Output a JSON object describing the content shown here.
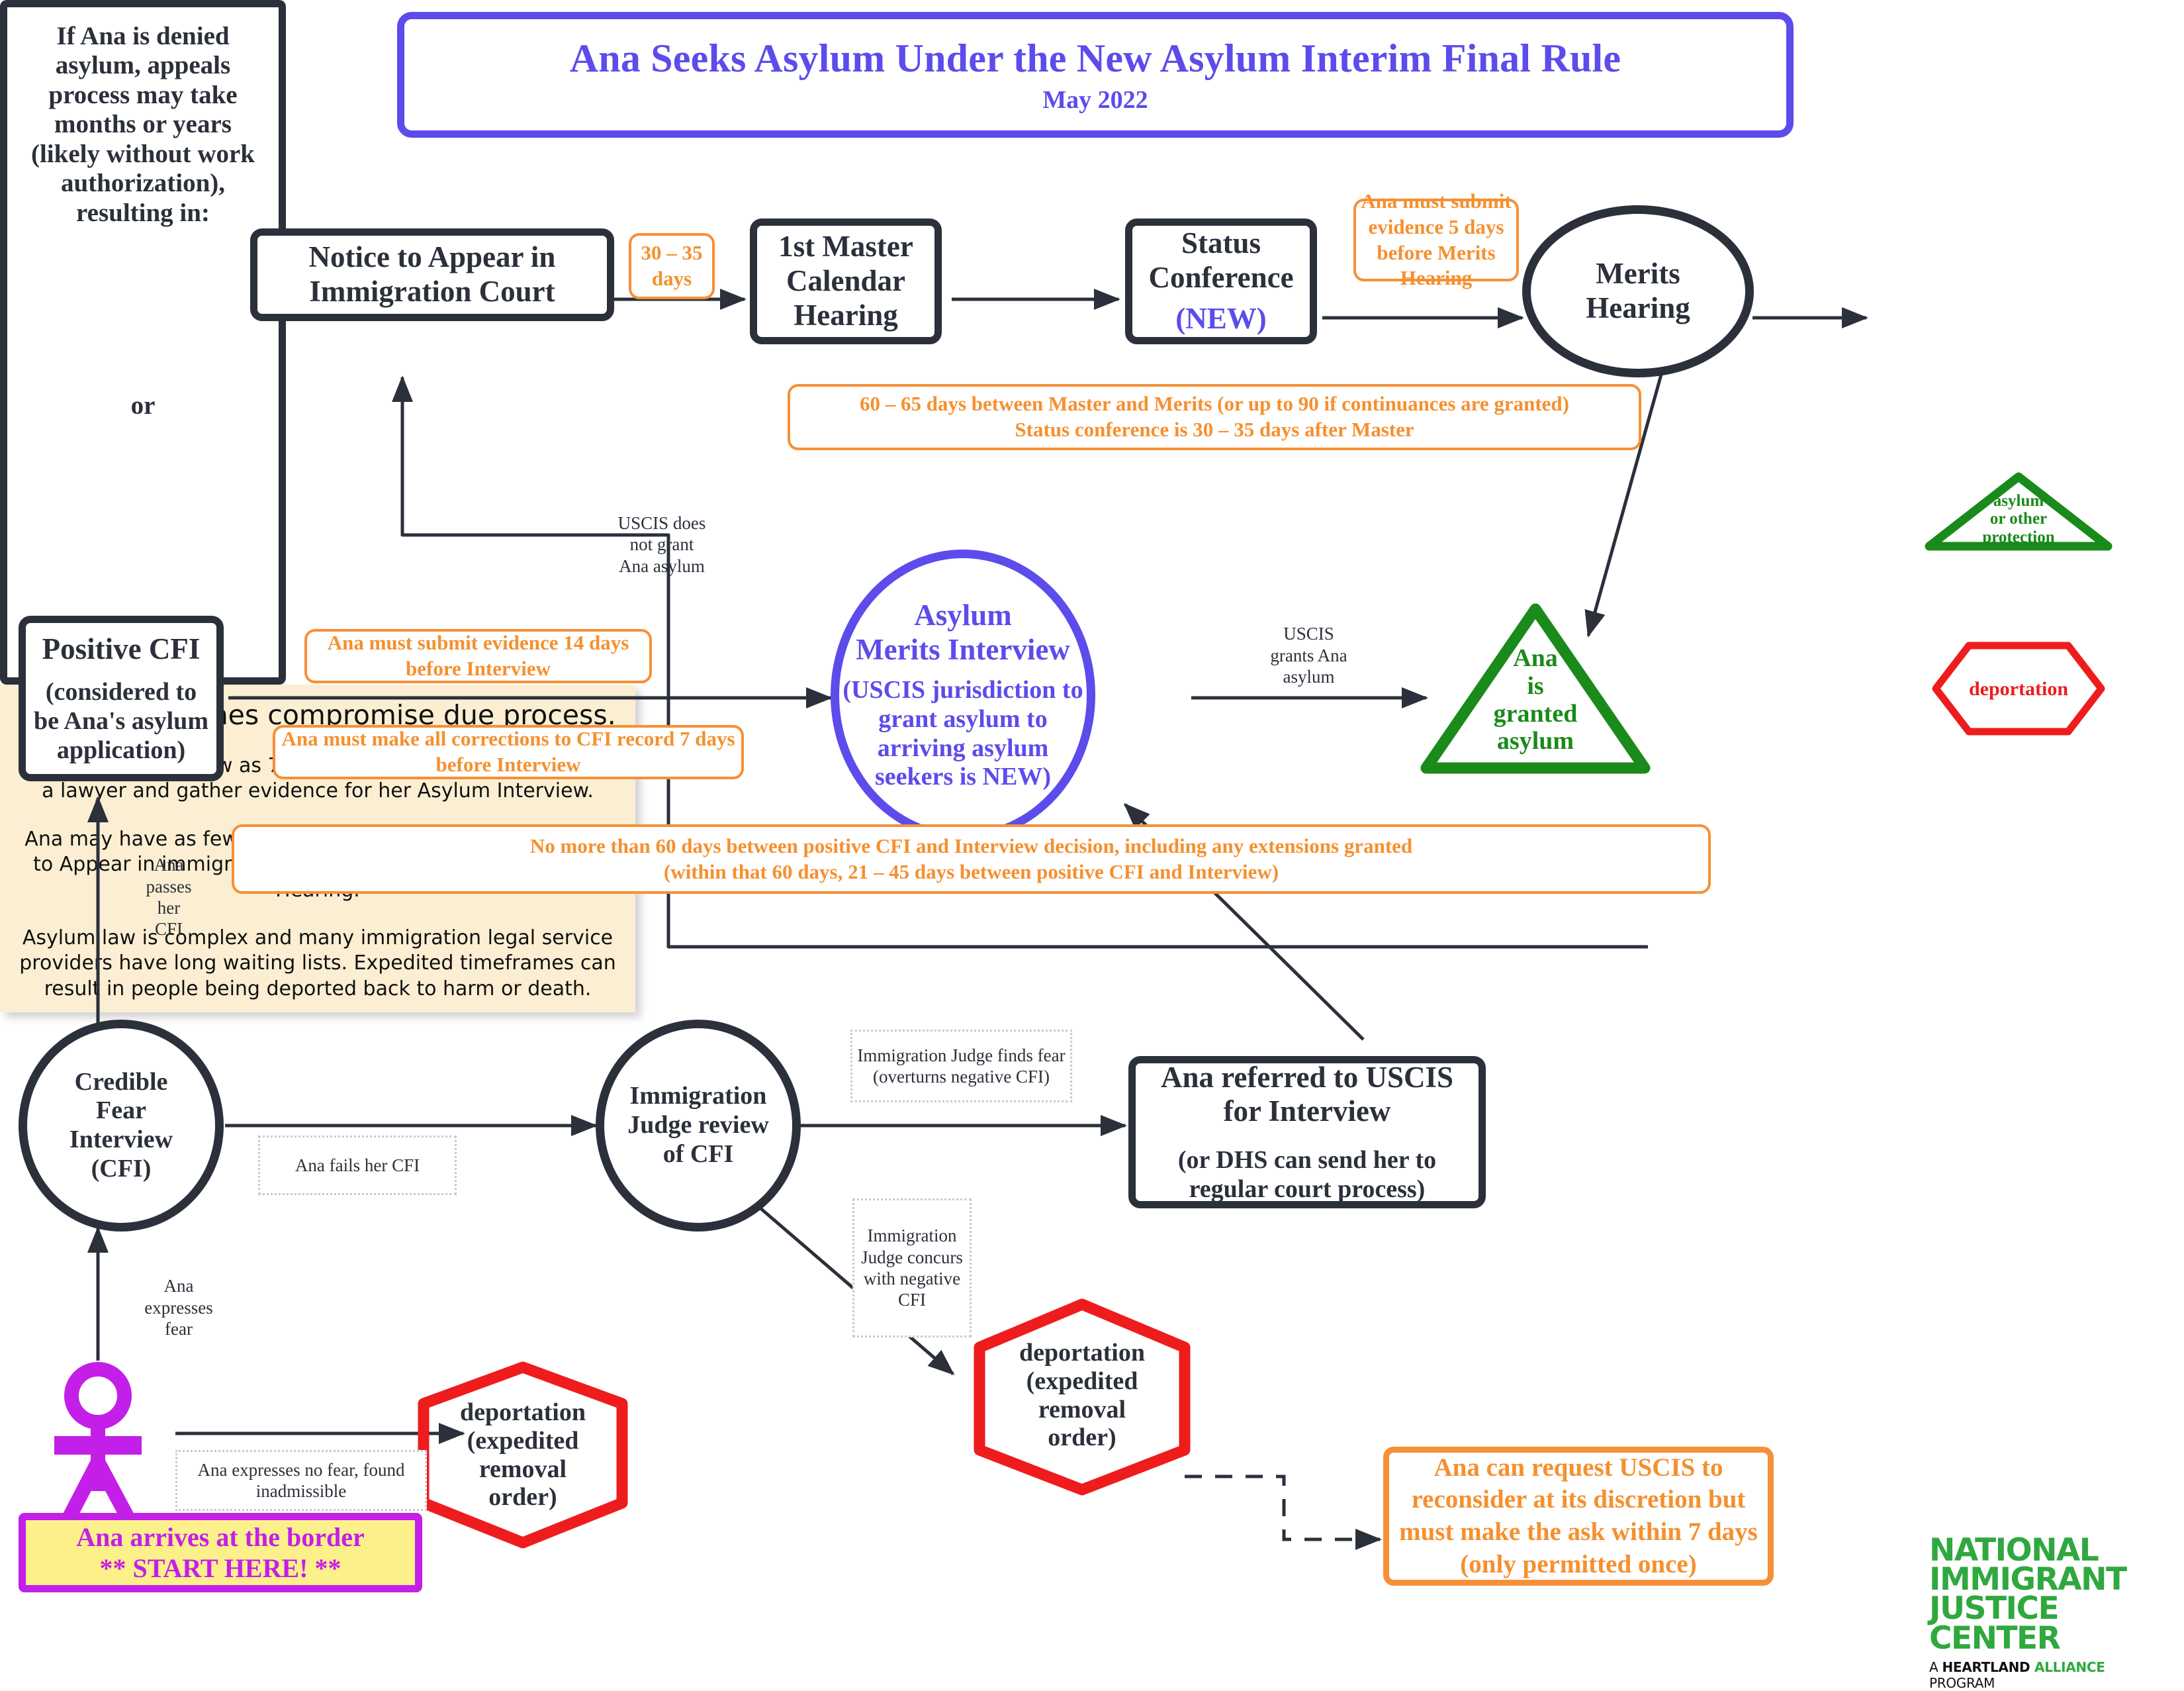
{
  "title": {
    "main": "Ana Seeks Asylum Under the New Asylum Interim Final Rule",
    "subtitle": "May 2022",
    "icon": "stick-figure-person-icon"
  },
  "colors": {
    "accent_purple": "#5c4ceb",
    "magenta": "#c31fe8",
    "orange": "#f5902f",
    "dark": "#2b303b",
    "green": "#1a8a1a",
    "red": "#ee1c1c",
    "cream": "#fbeed2",
    "yellow": "#fcf08a"
  },
  "nodes": {
    "notice_to_appear": "Notice to Appear in\nImmigration Court",
    "master_calendar": "1st Master\nCalendar\nHearing",
    "status_conference": "Status\nConference",
    "status_conference_new": "(NEW)",
    "merits_hearing": "Merits\nHearing",
    "positive_cfi_title": "Positive CFI",
    "positive_cfi_sub": "(considered to\nbe Ana's asylum\napplication)",
    "asylum_merits_interview_title": "Asylum\nMerits Interview",
    "asylum_merits_interview_sub": "(USCIS jurisdiction to\ngrant asylum to\narriving asylum\nseekers is NEW)",
    "ana_granted_asylum": "Ana\nis\ngranted\nasylum",
    "credible_fear_interview": "Credible\nFear\nInterview\n(CFI)",
    "ij_review": "Immigration\nJudge review\nof CFI",
    "referred_uscis_title": "Ana referred to USCIS\nfor Interview",
    "referred_uscis_sub": "(or DHS can send her to\nregular court process)",
    "deportation_left": "deportation\n(expedited\nremoval\norder)",
    "deportation_mid": "deportation\n(expedited\nremoval\norder)",
    "asylum_or_other_protection": "asylum\nor other\nprotection",
    "deportation_right": "deportation"
  },
  "appeals_panel": {
    "text": "If Ana is denied asylum, appeals process may take months or years (likely without work authorization), resulting in:",
    "or": "or"
  },
  "timing_notes": {
    "days_30_35": "30 – 35\ndays",
    "evidence_5_days": "Ana must submit\nevidence 5 days\nbefore Merits\nHearing",
    "master_merits": "60 – 65 days between Master and Merits (or up to 90 if continuances are granted)\nStatus conference is 30 – 35 days after Master",
    "evidence_14_days": "Ana must submit evidence 14 days\nbefore Interview",
    "corrections_7_days": "Ana must make all corrections to CFI record 7 days\nbefore Interview",
    "sixty_days": "No more than 60 days between positive CFI and Interview decision, including any extensions granted\n(within that 60 days, 21 – 45 days between positive CFI and Interview)",
    "reconsider": "Ana can request USCIS to reconsider at its discretion but must make the ask within 7 days (only permitted once)"
  },
  "edge_labels": {
    "uscis_not_grant": "USCIS does\nnot grant\nAna asylum",
    "uscis_grants": "USCIS\ngrants Ana\nasylum",
    "ana_passes_cfi": "Ana\npasses\nher\nCFI",
    "ana_expresses_fear": "Ana\nexpresses\nfear",
    "ana_fails_cfi": "Ana fails her CFI",
    "ij_finds_fear": "Immigration Judge finds fear\n(overturns negative CFI)",
    "ij_concurs": "Immigration\nJudge concurs\nwith negative\nCFI",
    "no_fear_inadmissible": "Ana expresses no fear, found\ninadmissible"
  },
  "start": {
    "line1": "Ana arrives at the border",
    "line2": "** START HERE! **"
  },
  "logo": {
    "line1": "NATIONAL",
    "line2": "IMMIGRANT",
    "line3": "JUSTICE CENTER",
    "tag_a": "A ",
    "tag_heartland": "HEARTLAND ",
    "tag_alliance": "ALLIANCE ",
    "tag_program": "PROGRAM"
  }
}
